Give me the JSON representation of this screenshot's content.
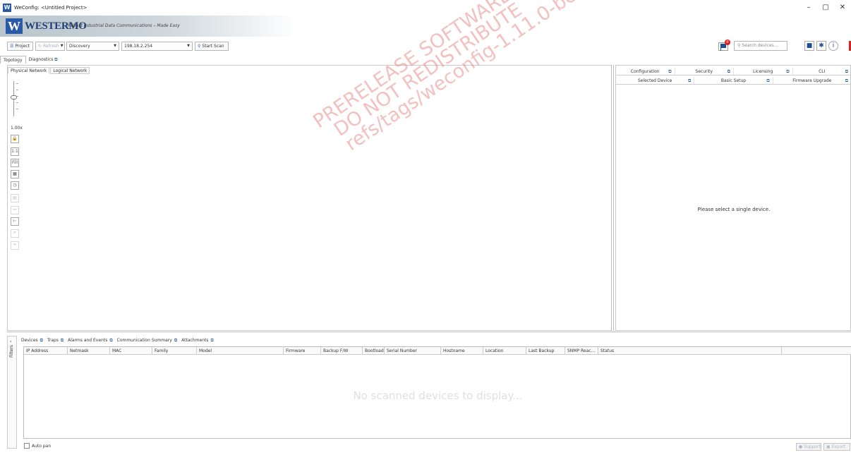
{
  "window": {
    "title": "WeConfig: <Untitled Project>",
    "app_icon": "W",
    "minimize": "–",
    "maximize": "▢",
    "close": "✕"
  },
  "banner": {
    "logo_mark": "W",
    "logo_word": "WESTERMO",
    "tagline": "Robust Industrial Data Communications – Made Easy"
  },
  "toolbar": {
    "project_label": "Project",
    "refresh_label": "Refresh",
    "discovery_value": "Discovery",
    "ip_value": "198.18.2.254",
    "start_scan_label": "Start Scan",
    "flag_badge": "0",
    "search_placeholder": "Search devices..."
  },
  "main_tabs": [
    "Topology",
    "Diagnostics"
  ],
  "left_pane": {
    "sub_tabs": [
      "Physical Network",
      "Logical Network"
    ],
    "zoom_label": "1.00x",
    "zoom_level": 0.55,
    "tools": [
      "lock",
      "1:1",
      "Fill",
      "grid",
      "clock",
      "page",
      "link",
      "wrench",
      "undo",
      "redo"
    ],
    "tool_labels": {
      "fit_11": "1:1",
      "fill": "Fill"
    },
    "watermark": [
      "PRERELEASE SOFTWARE",
      "DO NOT REDISTRIBUTE",
      "refs/tags/weconfig-1.11.0-beta3"
    ]
  },
  "right_pane": {
    "tabs_row1": [
      "Configuration",
      "Security",
      "Licensing",
      "CLI"
    ],
    "tabs_row2": [
      "Selected Device",
      "Basic Setup",
      "Firmware Upgrade"
    ],
    "placeholder": "Please select a single device."
  },
  "bottom": {
    "filters_label": "Filters",
    "tabs": [
      "Devices",
      "Traps",
      "Alarms and Events",
      "Communication Summary",
      "Attachments"
    ],
    "columns": [
      "IP Address",
      "Netmask",
      "MAC",
      "Family",
      "Model",
      "Firmware",
      "Backup F/W",
      "Bootload...",
      "Serial Number",
      "Hostname",
      "Location",
      "Last Backup",
      "SNMP Reac...",
      "Status"
    ],
    "empty_message": "No scanned devices to display...",
    "auto_pan_label": "Auto pan",
    "support_label": "Support",
    "export_label": "Export"
  }
}
